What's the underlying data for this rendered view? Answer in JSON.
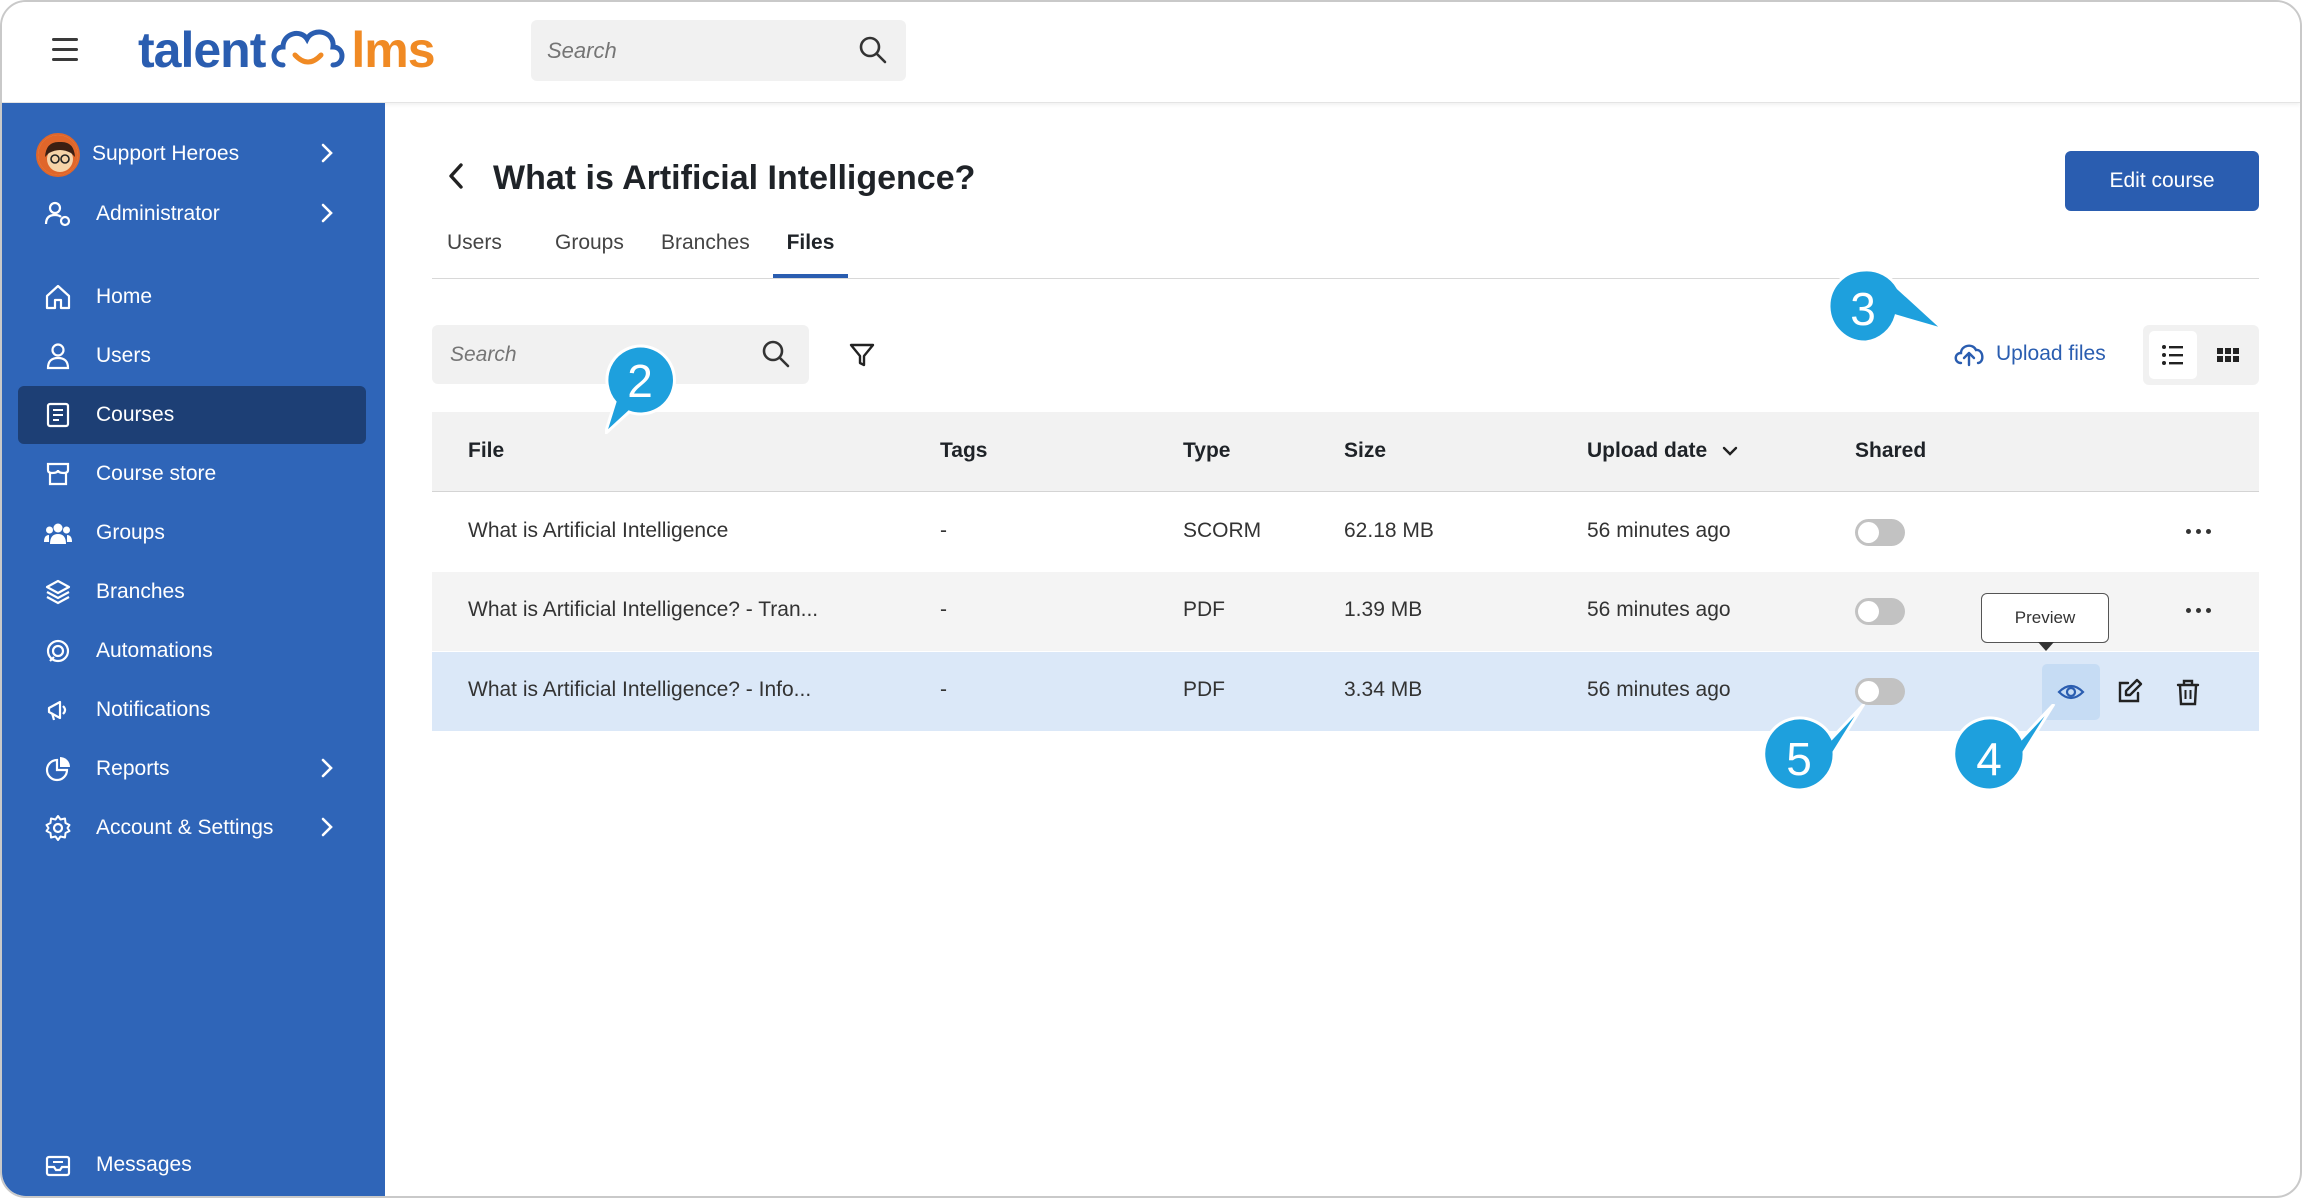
{
  "header": {
    "logo_left": "talent",
    "logo_right": "lms",
    "search_placeholder": "Search"
  },
  "sidebar": {
    "user": {
      "label": "Support Heroes"
    },
    "role": {
      "label": "Administrator"
    },
    "items": [
      {
        "label": "Home",
        "icon": "home-icon"
      },
      {
        "label": "Users",
        "icon": "user-icon"
      },
      {
        "label": "Courses",
        "icon": "courses-icon",
        "active": true
      },
      {
        "label": "Course store",
        "icon": "store-icon"
      },
      {
        "label": "Groups",
        "icon": "groups-icon"
      },
      {
        "label": "Branches",
        "icon": "branches-icon"
      },
      {
        "label": "Automations",
        "icon": "automations-icon"
      },
      {
        "label": "Notifications",
        "icon": "notifications-icon"
      },
      {
        "label": "Reports",
        "icon": "reports-icon"
      },
      {
        "label": "Account & Settings",
        "icon": "settings-icon"
      }
    ],
    "messages": {
      "label": "Messages"
    }
  },
  "main": {
    "title": "What is Artificial Intelligence?",
    "edit_button": "Edit course",
    "tabs": [
      "Users",
      "Groups",
      "Branches",
      "Files"
    ],
    "active_tab": "Files",
    "search_placeholder": "Search",
    "upload_label": "Upload files",
    "columns": [
      "File",
      "Tags",
      "Type",
      "Size",
      "Upload date",
      "Shared"
    ],
    "rows": [
      {
        "file": "What is Artificial Intelligence",
        "tags": "-",
        "type": "SCORM",
        "size": "62.18 MB",
        "date": "56 minutes ago",
        "shared": false
      },
      {
        "file": "What is Artificial Intelligence? - Tran...",
        "tags": "-",
        "type": "PDF",
        "size": "1.39 MB",
        "date": "56 minutes ago",
        "shared": false
      },
      {
        "file": "What is Artificial Intelligence? - Info...",
        "tags": "-",
        "type": "PDF",
        "size": "3.34 MB",
        "date": "56 minutes ago",
        "shared": false
      }
    ],
    "tooltip": "Preview"
  },
  "callouts": [
    "2",
    "3",
    "4",
    "5"
  ],
  "colors": {
    "brand": "#2f65b8",
    "accent": "#f08a24",
    "active_nav": "#1d3f75",
    "callout": "#1ea0dd"
  }
}
